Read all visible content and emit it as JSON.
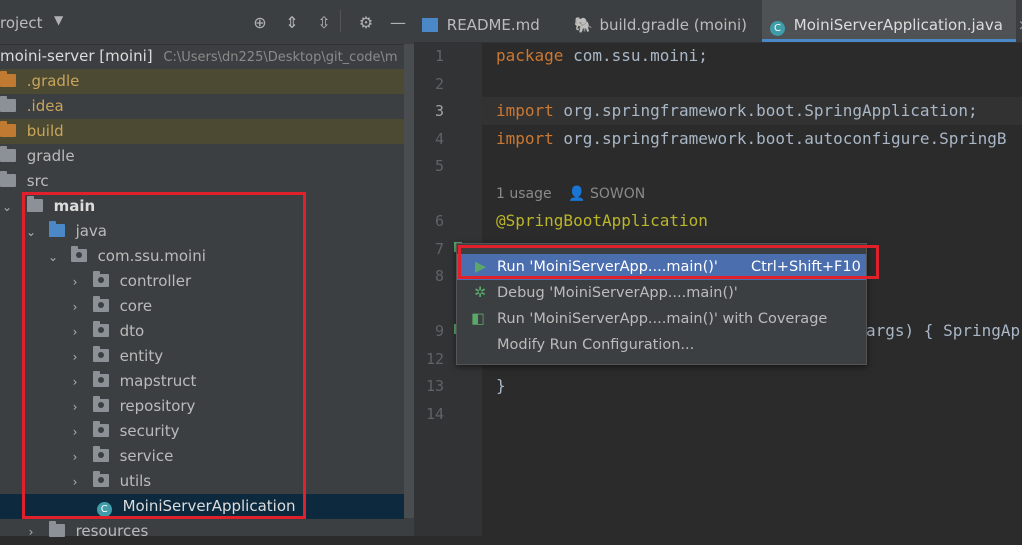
{
  "project_panel": {
    "title": "roject",
    "root_label": "moini-server [moini]",
    "root_path": "C:\\Users\\dn225\\Desktop\\git_code\\m",
    "items": [
      {
        "label": ".gradle"
      },
      {
        "label": ".idea"
      },
      {
        "label": "build"
      },
      {
        "label": "gradle"
      },
      {
        "label": "src"
      },
      {
        "label": "main"
      },
      {
        "label": "java"
      },
      {
        "label": "com.ssu.moini"
      },
      {
        "label": "controller"
      },
      {
        "label": "core"
      },
      {
        "label": "dto"
      },
      {
        "label": "entity"
      },
      {
        "label": "mapstruct"
      },
      {
        "label": "repository"
      },
      {
        "label": "security"
      },
      {
        "label": "service"
      },
      {
        "label": "utils"
      },
      {
        "label": "MoiniServerApplication"
      },
      {
        "label": "resources"
      }
    ]
  },
  "tabs": [
    {
      "label": "README.md"
    },
    {
      "label": "build.gradle (moini)"
    },
    {
      "label": "MoiniServerApplication.java"
    }
  ],
  "editor": {
    "line_numbers": [
      "1",
      "2",
      "3",
      "4",
      "5",
      "6",
      "7",
      "8",
      "9",
      "12",
      "13",
      "14"
    ],
    "line1_kw": "package",
    "line1_rest": " com.ssu.moini;",
    "line3_kw": "import",
    "line3_rest": " org.springframework.boot.SpringApplication;",
    "line4_kw": "import",
    "line4_rest": " org.springframework.boot.autoconfigure.SpringB",
    "usage": "1 usage",
    "author": "SOWON",
    "annotation": "@SpringBootApplication",
    "line9_tail": "args) { SpringAp",
    "line13": "}"
  },
  "context_menu": {
    "items": [
      {
        "label": "Run 'MoiniServerApp....main()'",
        "shortcut": "Ctrl+Shift+F10"
      },
      {
        "label": "Debug 'MoiniServerApp....main()'",
        "shortcut": ""
      },
      {
        "label": "Run 'MoiniServerApp....main()' with Coverage",
        "shortcut": ""
      },
      {
        "label": "Modify Run Configuration...",
        "shortcut": ""
      }
    ]
  }
}
